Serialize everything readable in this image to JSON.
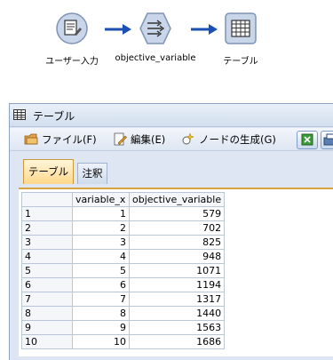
{
  "stream": {
    "nodes": [
      {
        "label": "ユーザー入力",
        "icon": "user-input-icon"
      },
      {
        "label": "objective_variable",
        "icon": "derive-icon"
      },
      {
        "label": "テーブル",
        "icon": "table-icon"
      }
    ]
  },
  "window": {
    "title": "テーブル",
    "menu": {
      "file": "ファイル(F)",
      "edit": "編集(E)",
      "generate": "ノードの生成(G)"
    },
    "tabs": {
      "table": "テーブル",
      "annotations": "注釈"
    },
    "table": {
      "columns": [
        "variable_x",
        "objective_variable"
      ],
      "rows": [
        {
          "n": "1",
          "x": "1",
          "y": "579"
        },
        {
          "n": "2",
          "x": "2",
          "y": "702"
        },
        {
          "n": "3",
          "x": "3",
          "y": "825"
        },
        {
          "n": "4",
          "x": "4",
          "y": "948"
        },
        {
          "n": "5",
          "x": "5",
          "y": "1071"
        },
        {
          "n": "6",
          "x": "6",
          "y": "1194"
        },
        {
          "n": "7",
          "x": "7",
          "y": "1317"
        },
        {
          "n": "8",
          "x": "8",
          "y": "1440"
        },
        {
          "n": "9",
          "x": "9",
          "y": "1563"
        },
        {
          "n": "10",
          "x": "10",
          "y": "1686"
        }
      ]
    }
  },
  "colors": {
    "node_fill": "#c9d6ea",
    "arrow": "#1a4fb3",
    "active_tab": "#ffd78a",
    "window_bg": "#dde6f2"
  }
}
